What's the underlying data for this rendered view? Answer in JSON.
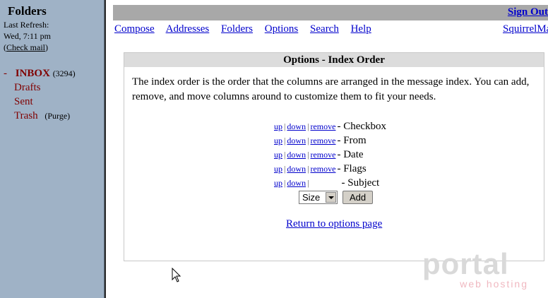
{
  "left_frame": {
    "title": "Folders",
    "last_refresh_label": "Last Refresh:",
    "last_refresh_time": "Wed, 7:11 pm",
    "check_mail": "Check mail",
    "folders": [
      {
        "marker": "-",
        "name": "INBOX",
        "count": "(3294)"
      },
      {
        "name": "Drafts"
      },
      {
        "name": "Sent"
      },
      {
        "name": "Trash",
        "action": "(Purge)"
      }
    ]
  },
  "top": {
    "sign_out": "Sign Out",
    "nav": [
      "Compose",
      "Addresses",
      "Folders",
      "Options",
      "Search",
      "Help"
    ],
    "brand": "SquirrelMail"
  },
  "panel": {
    "title": "Options - Index Order",
    "intro": "The index order is the order that the columns are arranged in the message index. You can add, remove, and move columns around to customize them to fit your needs.",
    "link_up": "up",
    "link_down": "down",
    "link_remove": "remove",
    "columns": [
      "- Checkbox",
      "- From",
      "- Date",
      "- Flags",
      "- Subject"
    ],
    "add_select_value": "Size",
    "add_button": "Add",
    "return_link": "Return to options page"
  },
  "watermark": {
    "main": "portal",
    "sub": "web hosting"
  },
  "colors": {
    "left_frame_bg": "#9fb2c6",
    "folder_color": "#800000",
    "link_color": "#0000cc",
    "topbar": "#a8a8a8"
  }
}
